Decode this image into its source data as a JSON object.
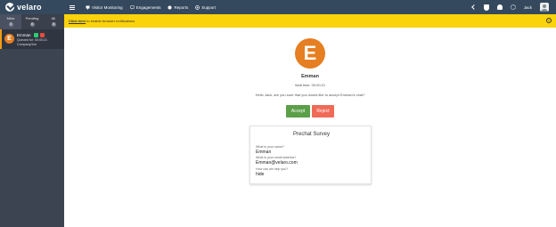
{
  "app": {
    "logo_text": "velaro"
  },
  "nav": {
    "items": [
      {
        "label": "Visitor Monitoring",
        "icon": "monitor-icon"
      },
      {
        "label": "Engagements",
        "icon": "chat-icon"
      },
      {
        "label": "Reports",
        "icon": "report-icon"
      },
      {
        "label": "Support",
        "icon": "support-icon"
      }
    ]
  },
  "user": {
    "name": "Jack"
  },
  "sidebar": {
    "tabs": [
      {
        "label": "Mine",
        "count": "0"
      },
      {
        "label": "Pending",
        "count": "0"
      },
      {
        "label": "All",
        "count": "0"
      }
    ],
    "chat": {
      "initial": "E",
      "name": "Emman",
      "queued": "Queued for: 00:00:21",
      "company": "CompanyOne"
    }
  },
  "notice": {
    "link": "Click here",
    "text": "to enable browser notifications"
  },
  "main": {
    "initial": "E",
    "visitor_name": "Emman",
    "wait_time": "Wait time: 00:00:21",
    "question": "Hello Jack, are you sure that you would like to accept Emman's chat?",
    "accept_label": "Accept",
    "reject_label": "Reject"
  },
  "survey": {
    "title": "Prechat Survey",
    "items": [
      {
        "question": "What is your name?",
        "answer": "Emman"
      },
      {
        "question": "What is your email address?",
        "answer": "Emman@velaro.com"
      },
      {
        "question": "How can we help you?",
        "answer": "hide"
      }
    ]
  },
  "colors": {
    "topbar": "#34495e",
    "sidebar": "#3d4451",
    "notice": "#fad30a",
    "accept": "#5b9f48",
    "reject": "#ef6b57",
    "avatar": "#e67e22"
  }
}
